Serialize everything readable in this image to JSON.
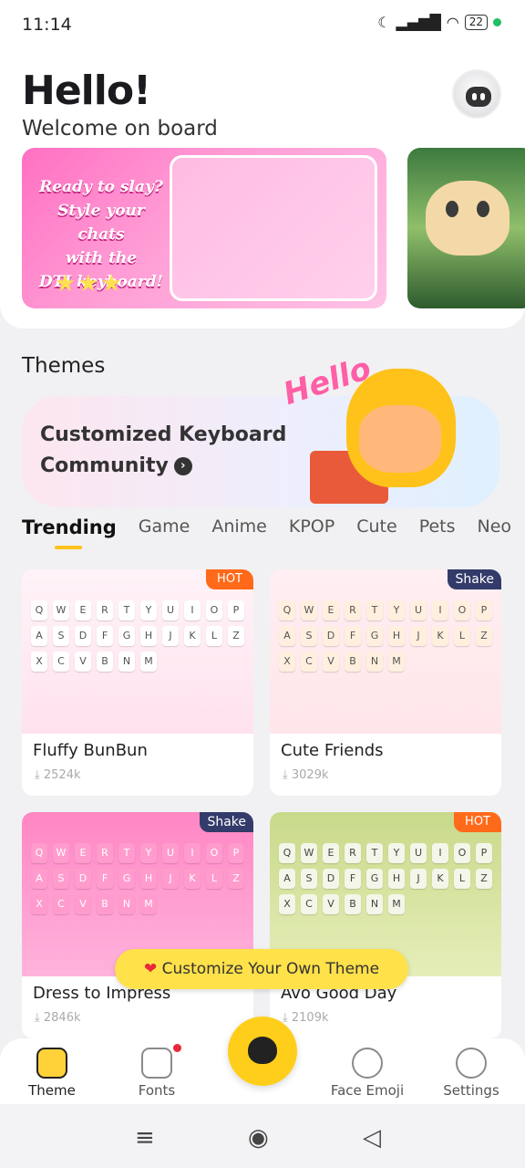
{
  "status": {
    "time": "11:14",
    "signal": "▂▄▆█",
    "wifi": "◠",
    "battery": "22"
  },
  "header": {
    "title": "Hello!",
    "subtitle": "Welcome on board"
  },
  "banner": {
    "text_lines": [
      "Ready to slay?",
      "Style your chats",
      "with the",
      "DTI keyboard!"
    ]
  },
  "themes": {
    "title": "Themes",
    "community_line1": "Customized Keyboard",
    "community_line2": "Community",
    "community_tag": "Hello"
  },
  "tabs": [
    "Trending",
    "Game",
    "Anime",
    "KPOP",
    "Cute",
    "Pets",
    "Neo"
  ],
  "cards": [
    {
      "name": "Fluffy BunBun",
      "downloads": "2524k",
      "badge": "HOT"
    },
    {
      "name": "Cute Friends",
      "downloads": "3029k",
      "badge": "Shake"
    },
    {
      "name": "Dress to Impress",
      "downloads": "2846k",
      "badge": "Shake"
    },
    {
      "name": "Avo Good Day",
      "downloads": "2109k",
      "badge": "HOT"
    }
  ],
  "keyrow": [
    "Q",
    "W",
    "E",
    "R",
    "T",
    "Y",
    "U",
    "I",
    "O",
    "P",
    "A",
    "S",
    "D",
    "F",
    "G",
    "H",
    "J",
    "K",
    "L",
    "Z",
    "X",
    "C",
    "V",
    "B",
    "N",
    "M"
  ],
  "customize": {
    "label": "Customize Your Own Theme"
  },
  "nav": {
    "theme": "Theme",
    "fonts": "Fonts",
    "face_emoji": "Face Emoji",
    "settings": "Settings"
  },
  "colors": {
    "accent": "#ffce1a",
    "hot": "#ff6a1a",
    "shake": "#333b6a"
  }
}
